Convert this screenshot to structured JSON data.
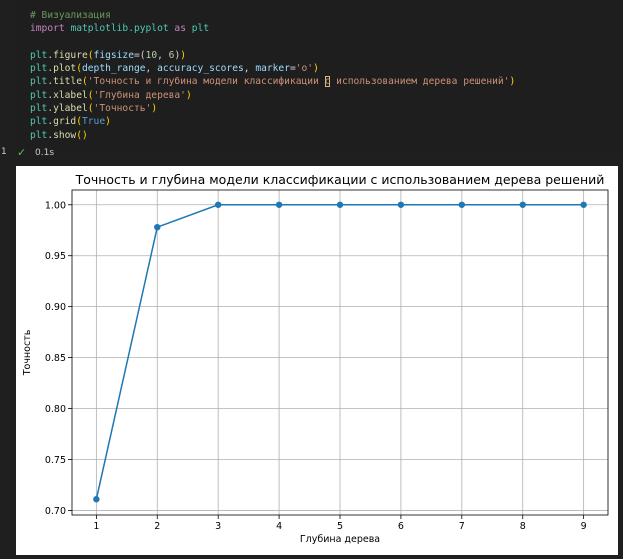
{
  "code_cell": {
    "lines": [
      [
        {
          "t": "# Визуализация",
          "c": "comment"
        }
      ],
      [
        {
          "t": "import",
          "c": "kw"
        },
        {
          "t": " ",
          "c": "plain"
        },
        {
          "t": "matplotlib.pyplot",
          "c": "mod"
        },
        {
          "t": " ",
          "c": "plain"
        },
        {
          "t": "as",
          "c": "kw"
        },
        {
          "t": " ",
          "c": "plain"
        },
        {
          "t": "plt",
          "c": "mod"
        }
      ],
      [],
      [
        {
          "t": "plt",
          "c": "mod"
        },
        {
          "t": ".",
          "c": "plain"
        },
        {
          "t": "figure",
          "c": "fn"
        },
        {
          "t": "(",
          "c": "paren"
        },
        {
          "t": "figsize",
          "c": "var"
        },
        {
          "t": "=",
          "c": "plain"
        },
        {
          "t": "(",
          "c": "plain"
        },
        {
          "t": "10",
          "c": "num"
        },
        {
          "t": ", ",
          "c": "plain"
        },
        {
          "t": "6",
          "c": "num"
        },
        {
          "t": ")",
          "c": "plain"
        },
        {
          "t": ")",
          "c": "paren"
        }
      ],
      [
        {
          "t": "plt",
          "c": "mod"
        },
        {
          "t": ".",
          "c": "plain"
        },
        {
          "t": "plot",
          "c": "fn"
        },
        {
          "t": "(",
          "c": "paren"
        },
        {
          "t": "depth_range",
          "c": "var"
        },
        {
          "t": ", ",
          "c": "plain"
        },
        {
          "t": "accuracy_scores",
          "c": "var"
        },
        {
          "t": ", ",
          "c": "plain"
        },
        {
          "t": "marker",
          "c": "var"
        },
        {
          "t": "=",
          "c": "plain"
        },
        {
          "t": "'o'",
          "c": "str"
        },
        {
          "t": ")",
          "c": "paren"
        }
      ],
      [
        {
          "t": "plt",
          "c": "mod"
        },
        {
          "t": ".",
          "c": "plain"
        },
        {
          "t": "title",
          "c": "fn"
        },
        {
          "t": "(",
          "c": "paren"
        },
        {
          "t": "'Точность и глубина модели классификации ",
          "c": "str"
        },
        {
          "t": "с",
          "c": "str hl-box"
        },
        {
          "t": " использованием дерева решений'",
          "c": "str"
        },
        {
          "t": ")",
          "c": "paren"
        }
      ],
      [
        {
          "t": "plt",
          "c": "mod"
        },
        {
          "t": ".",
          "c": "plain"
        },
        {
          "t": "xlabel",
          "c": "fn"
        },
        {
          "t": "(",
          "c": "paren"
        },
        {
          "t": "'Глубина дерева'",
          "c": "str"
        },
        {
          "t": ")",
          "c": "paren"
        }
      ],
      [
        {
          "t": "plt",
          "c": "mod"
        },
        {
          "t": ".",
          "c": "plain"
        },
        {
          "t": "ylabel",
          "c": "fn"
        },
        {
          "t": "(",
          "c": "paren"
        },
        {
          "t": "'Точность'",
          "c": "str"
        },
        {
          "t": ")",
          "c": "paren"
        }
      ],
      [
        {
          "t": "plt",
          "c": "mod"
        },
        {
          "t": ".",
          "c": "plain"
        },
        {
          "t": "grid",
          "c": "fn"
        },
        {
          "t": "(",
          "c": "paren"
        },
        {
          "t": "True",
          "c": "bool"
        },
        {
          "t": ")",
          "c": "paren"
        }
      ],
      [
        {
          "t": "plt",
          "c": "mod"
        },
        {
          "t": ".",
          "c": "plain"
        },
        {
          "t": "show",
          "c": "fn"
        },
        {
          "t": "()",
          "c": "paren"
        }
      ]
    ]
  },
  "status": {
    "edge_mark": "1",
    "check_icon": "✓",
    "duration": "0.1s"
  },
  "chart_data": {
    "type": "line",
    "title": "Точность и глубина модели классификации с использованием дерева решений",
    "xlabel": "Глубина дерева",
    "ylabel": "Точность",
    "x": [
      1,
      2,
      3,
      4,
      5,
      6,
      7,
      8,
      9
    ],
    "series": [
      {
        "values": [
          0.711,
          0.978,
          1.0,
          1.0,
          1.0,
          1.0,
          1.0,
          1.0,
          1.0
        ],
        "color": "#1f77b4",
        "marker": "o"
      }
    ],
    "xticks": [
      "1",
      "2",
      "3",
      "4",
      "5",
      "6",
      "7",
      "8",
      "9"
    ],
    "yticks": [
      "0.70",
      "0.75",
      "0.80",
      "0.85",
      "0.90",
      "0.95",
      "1.00"
    ],
    "xlim": [
      0.6,
      9.4
    ],
    "ylim": [
      0.6955,
      1.0145
    ],
    "grid": true
  }
}
